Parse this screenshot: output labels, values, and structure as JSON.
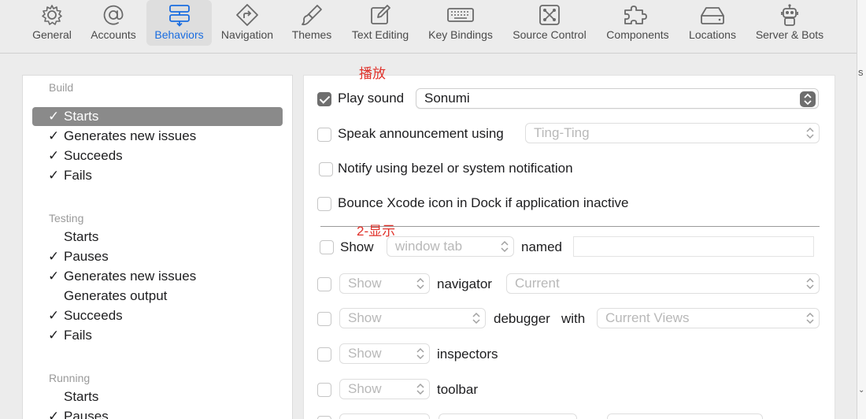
{
  "toolbar": {
    "items": [
      {
        "label": "General",
        "icon": "gear-icon"
      },
      {
        "label": "Accounts",
        "icon": "at-sign-icon"
      },
      {
        "label": "Behaviors",
        "icon": "behaviors-icon"
      },
      {
        "label": "Navigation",
        "icon": "navigation-icon"
      },
      {
        "label": "Themes",
        "icon": "paintbrush-icon"
      },
      {
        "label": "Text Editing",
        "icon": "pencil-square-icon"
      },
      {
        "label": "Key Bindings",
        "icon": "keyboard-icon"
      },
      {
        "label": "Source Control",
        "icon": "source-control-icon"
      },
      {
        "label": "Components",
        "icon": "puzzle-icon"
      },
      {
        "label": "Locations",
        "icon": "drive-icon"
      },
      {
        "label": "Server & Bots",
        "icon": "robot-icon"
      }
    ],
    "selected": "Behaviors",
    "accent_color": "#1a6de0"
  },
  "behaviors_list": {
    "check_mark": "✓",
    "sections": [
      {
        "title": "Build",
        "items": [
          {
            "label": "Starts",
            "checked": true,
            "selected": true
          },
          {
            "label": "Generates new issues",
            "checked": true
          },
          {
            "label": "Succeeds",
            "checked": true
          },
          {
            "label": "Fails",
            "checked": true
          }
        ]
      },
      {
        "title": "Testing",
        "items": [
          {
            "label": "Starts",
            "checked": false
          },
          {
            "label": "Pauses",
            "checked": true
          },
          {
            "label": "Generates new issues",
            "checked": true
          },
          {
            "label": "Generates output",
            "checked": false
          },
          {
            "label": "Succeeds",
            "checked": true
          },
          {
            "label": "Fails",
            "checked": true
          }
        ]
      },
      {
        "title": "Running",
        "items": [
          {
            "label": "Starts",
            "checked": false
          },
          {
            "label": "Pauses",
            "checked": true
          }
        ]
      }
    ]
  },
  "settings": {
    "play_sound": {
      "label": "Play sound",
      "checked": true,
      "value": "Sonumi"
    },
    "speak": {
      "label": "Speak announcement using",
      "checked": false,
      "value": "Ting-Ting"
    },
    "notify": {
      "label": "Notify using bezel or system notification",
      "checked": false
    },
    "bounce": {
      "label": "Bounce Xcode icon in Dock if application inactive",
      "checked": false
    },
    "show_tab": {
      "label": "Show",
      "checked": false,
      "popup": "window tab",
      "named_label": "named",
      "named_value": ""
    },
    "navigator": {
      "checked": false,
      "popup": "Show",
      "label": "navigator",
      "value": "Current"
    },
    "debugger": {
      "checked": false,
      "popup": "Show",
      "label": "debugger",
      "with_label": "with",
      "value": "Current Views"
    },
    "inspectors": {
      "checked": false,
      "popup": "Show",
      "label": "inspectors"
    },
    "toolbar_row": {
      "checked": false,
      "popup": "Show",
      "label": "toolbar"
    }
  },
  "annotations": {
    "play": "播放",
    "show": "2-显示",
    "color": "#e0312a"
  },
  "side_strip": {
    "char": "s",
    "chevron": "⌄"
  }
}
